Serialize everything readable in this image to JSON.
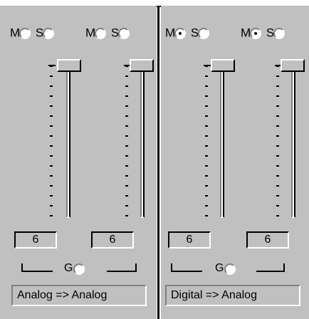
{
  "channels": [
    {
      "mono_label": "M",
      "stereo_label": "S",
      "mode": "none",
      "value": "6"
    },
    {
      "mono_label": "M",
      "stereo_label": "S",
      "mode": "none",
      "value": "6"
    },
    {
      "mono_label": "M",
      "stereo_label": "S",
      "mode": "mono",
      "value": "6"
    },
    {
      "mono_label": "M",
      "stereo_label": "S",
      "mode": "mono",
      "value": "6"
    }
  ],
  "groups": [
    {
      "gang_label": "G",
      "route_label": "Analog => Analog"
    },
    {
      "gang_label": "G",
      "route_label": "Digital => Analog"
    }
  ],
  "colors": {
    "face": "#c0c0c0",
    "shadow": "#808080",
    "highlight": "#ffffff",
    "text": "#000000"
  }
}
